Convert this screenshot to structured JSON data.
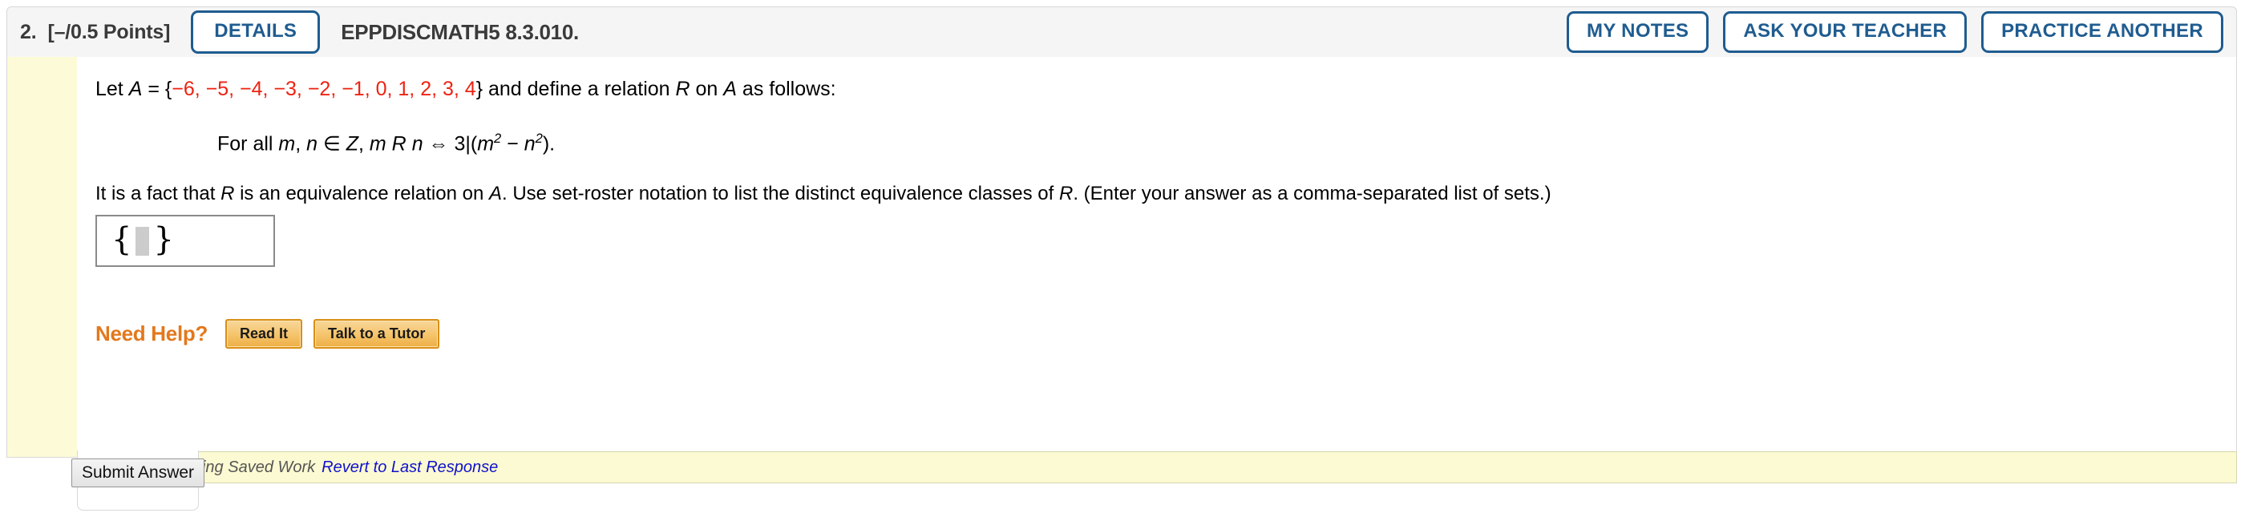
{
  "header": {
    "question_number": "2.",
    "points": "[–/0.5 Points]",
    "details_label": "DETAILS",
    "assignment_code": "EPPDISCMATH5 8.3.010.",
    "actions": [
      {
        "label": "MY NOTES",
        "name": "my-notes-button"
      },
      {
        "label": "ASK YOUR TEACHER",
        "name": "ask-your-teacher-button"
      },
      {
        "label": "PRACTICE ANOTHER",
        "name": "practice-another-button"
      }
    ]
  },
  "question": {
    "line1_prefix": "Let ",
    "line1_varA": "A",
    "line1_eq": " = {",
    "line1_set": "−6, −5, −4, −3, −2, −1, 0, 1, 2, 3, 4",
    "line1_close": "} and define a relation ",
    "line1_varR": "R",
    "line1_on": " on ",
    "line1_varA2": "A",
    "line1_suffix": " as follows:",
    "line2_forall": "For all ",
    "line2_m": "m",
    "line2_comma": ", ",
    "line2_n": "n",
    "line2_in": " ∈ ",
    "line2_Z": "Z",
    "line2_comma2": ", ",
    "line2_m2": "m",
    "line2_R": " R ",
    "line2_n2": "n",
    "line2_iff": " ⇔ 3|(",
    "line2_msq_base": "m",
    "line2_msq_exp": "2",
    "line2_minus": " − ",
    "line2_nsq_base": "n",
    "line2_nsq_exp": "2",
    "line2_end": ").",
    "line3_a": "It is a fact that ",
    "line3_R": "R",
    "line3_b": " is an equivalence relation on ",
    "line3_A": "A",
    "line3_c": ". Use set-roster notation to list the distinct equivalence classes of ",
    "line3_R2": "R",
    "line3_d": ". (Enter your answer as a comma-separated list of sets.)"
  },
  "answer": {
    "open_brace": "{",
    "close_brace": "}",
    "value": "",
    "placeholder": ""
  },
  "need_help": {
    "label": "Need Help?",
    "buttons": [
      {
        "label": "Read It",
        "name": "read-it-button"
      },
      {
        "label": "Talk to a Tutor",
        "name": "talk-to-a-tutor-button"
      }
    ]
  },
  "footer": {
    "submit_label": "Submit Answer",
    "saved_work_text": "Viewing Saved Work",
    "revert_link": "Revert to Last Response"
  },
  "colors": {
    "accent_blue": "#1f5c90",
    "set_red": "#ee2211",
    "need_help_orange": "#e3781c",
    "link_blue": "#1111cc",
    "saved_bar_bg": "#fbfad2",
    "strip_yellow": "#fdfbd7"
  }
}
